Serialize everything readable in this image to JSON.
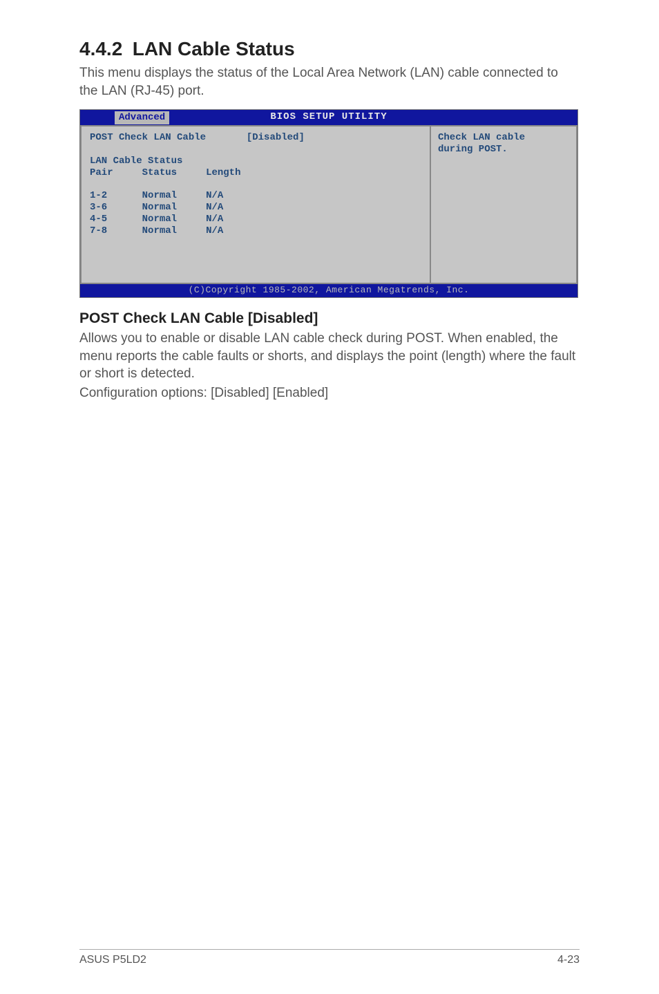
{
  "heading": {
    "number": "4.4.2",
    "title": "LAN Cable Status"
  },
  "intro": "This menu displays the status of the Local Area Network (LAN) cable connected to the LAN (RJ-45) port.",
  "bios": {
    "title": "BIOS SETUP UTILITY",
    "tab": "Advanced",
    "post_check_label": "POST Check LAN Cable",
    "post_check_value": "[Disabled]",
    "section_label": "LAN Cable Status",
    "columns": {
      "c1": "Pair",
      "c2": "Status",
      "c3": "Length"
    },
    "rows": [
      {
        "pair": "1-2",
        "status": "Normal",
        "length": "N/A"
      },
      {
        "pair": "3-6",
        "status": "Normal",
        "length": "N/A"
      },
      {
        "pair": "4-5",
        "status": "Normal",
        "length": "N/A"
      },
      {
        "pair": "7-8",
        "status": "Normal",
        "length": "N/A"
      }
    ],
    "help_line1": "Check LAN cable",
    "help_line2": "during POST.",
    "copyright": "(C)Copyright 1985-2002, American Megatrends, Inc."
  },
  "subheading": "POST Check LAN Cable [Disabled]",
  "description": "Allows you to enable or disable LAN cable check during POST. When enabled, the menu reports the cable faults or shorts, and displays the point (length) where the fault or short is detected.",
  "config_line": "Configuration options: [Disabled] [Enabled]",
  "footer": {
    "left": "ASUS P5LD2",
    "right": "4-23"
  }
}
